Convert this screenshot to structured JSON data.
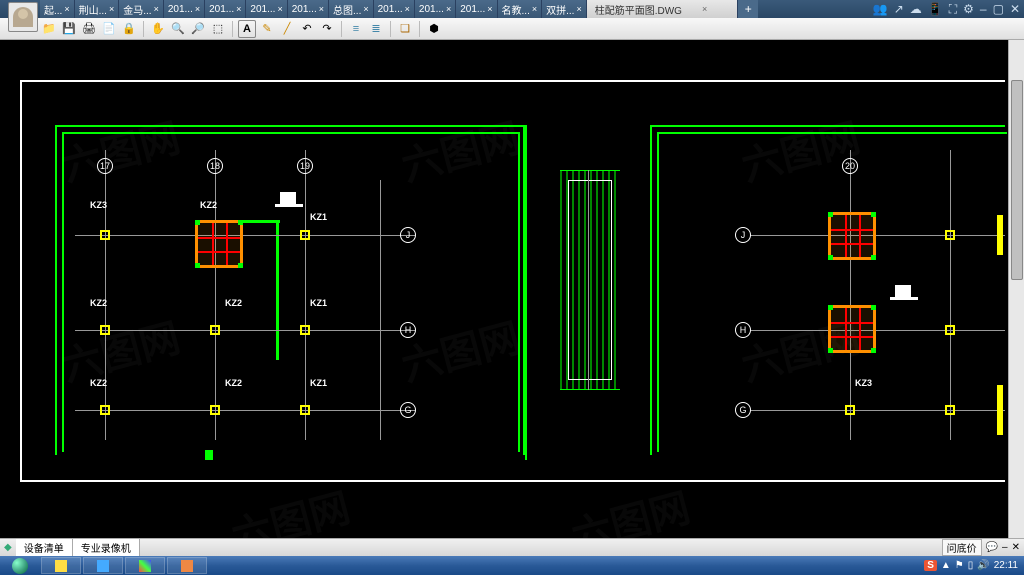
{
  "tabs": [
    {
      "label": "起...",
      "close": "×"
    },
    {
      "label": "荆山...",
      "close": "×"
    },
    {
      "label": "金马...",
      "close": "×"
    },
    {
      "label": "201...",
      "close": "×"
    },
    {
      "label": "201...",
      "close": "×"
    },
    {
      "label": "201...",
      "close": "×"
    },
    {
      "label": "201...",
      "close": "×"
    },
    {
      "label": "总图...",
      "close": "×"
    },
    {
      "label": "201...",
      "close": "×"
    },
    {
      "label": "201...",
      "close": "×"
    },
    {
      "label": "201...",
      "close": "×"
    },
    {
      "label": "名教...",
      "close": "×"
    },
    {
      "label": "双拼...",
      "close": "×"
    },
    {
      "label": "柱配筋平面图.DWG",
      "close": "×"
    }
  ],
  "add_tab": "+",
  "title_icons": {
    "users": "👥",
    "share": "↗",
    "cloud": "☁",
    "mobile": "📱",
    "full": "⛶",
    "gear": "⚙",
    "min": "–",
    "max": "▢",
    "close": "✕"
  },
  "toolbar": {
    "open": "📁",
    "save": "💾",
    "print": "🖨",
    "pdf": "📄",
    "lock": "🔒",
    "hand": "✋",
    "zoomin": "🔍",
    "zoomout": "🔎",
    "zoomfit": "⬚",
    "text": "A",
    "pen": "✎",
    "line": "╱",
    "undo": "↶",
    "redo": "↷",
    "layer1": "≡",
    "layer2": "≣",
    "layers": "❏",
    "prop": "⬢"
  },
  "drawing": {
    "grid_labels_top_left": [
      "17",
      "18",
      "19"
    ],
    "grid_labels_top_right": [
      "20"
    ],
    "grid_labels_side": [
      "J",
      "H",
      "G"
    ],
    "columns": {
      "kz1": "KZ1",
      "kz2": "KZ2",
      "kz3": "KZ3"
    }
  },
  "sheets": {
    "s1": "设备清单",
    "s2": "专业录像机"
  },
  "sheet_right": {
    "price": "问底价",
    "chat": "💬",
    "min": "–",
    "close": "✕"
  },
  "tray": {
    "time": "22:11",
    "s_icon": "S",
    "vol": "🔊",
    "net": "▯",
    "flag": "⚑",
    "up": "▲"
  },
  "watermark": "六图网"
}
